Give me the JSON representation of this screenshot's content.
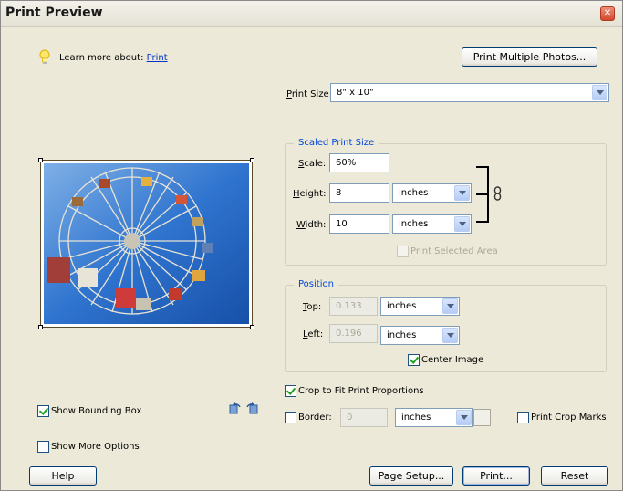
{
  "window": {
    "title": "Print Preview"
  },
  "learn_more": {
    "prefix": "Learn more about:",
    "link": "Print"
  },
  "buttons": {
    "print_multiple": "Print Multiple Photos...",
    "help": "Help",
    "page_setup": "Page Setup...",
    "print": "Print...",
    "reset": "Reset"
  },
  "print_size": {
    "label": "Print Size:",
    "value": "8\" x 10\""
  },
  "scaled_print_size": {
    "title": "Scaled Print Size",
    "scale_label": "Scale:",
    "scale_value": "60%",
    "height_label": "Height:",
    "height_value": "8",
    "height_unit": "inches",
    "width_label": "Width:",
    "width_value": "10",
    "width_unit": "inches",
    "print_selected_area": "Print Selected Area"
  },
  "position": {
    "title": "Position",
    "top_label": "Top:",
    "top_value": "0.133",
    "top_unit": "inches",
    "left_label": "Left:",
    "left_value": "0.196",
    "left_unit": "inches",
    "center_image": "Center Image"
  },
  "crop_to_fit": "Crop to Fit Print Proportions",
  "border": {
    "label": "Border:",
    "value": "0",
    "unit": "inches"
  },
  "print_crop_marks": "Print Crop Marks",
  "show_bounding_box": "Show Bounding Box",
  "show_more_options": "Show More Options",
  "checkbox_states": {
    "print_selected_area": false,
    "center_image": true,
    "crop_to_fit": true,
    "border": false,
    "print_crop_marks": false,
    "show_bounding_box": true,
    "show_more_options": false
  },
  "icons": {
    "lightbulb": "lightbulb-icon",
    "link": "chain-link-icon",
    "rotate_left": "rotate-left-icon",
    "rotate_right": "rotate-right-icon",
    "close": "close-icon"
  },
  "colors": {
    "accent": "#0046d5",
    "sky": "#1d63c4"
  }
}
